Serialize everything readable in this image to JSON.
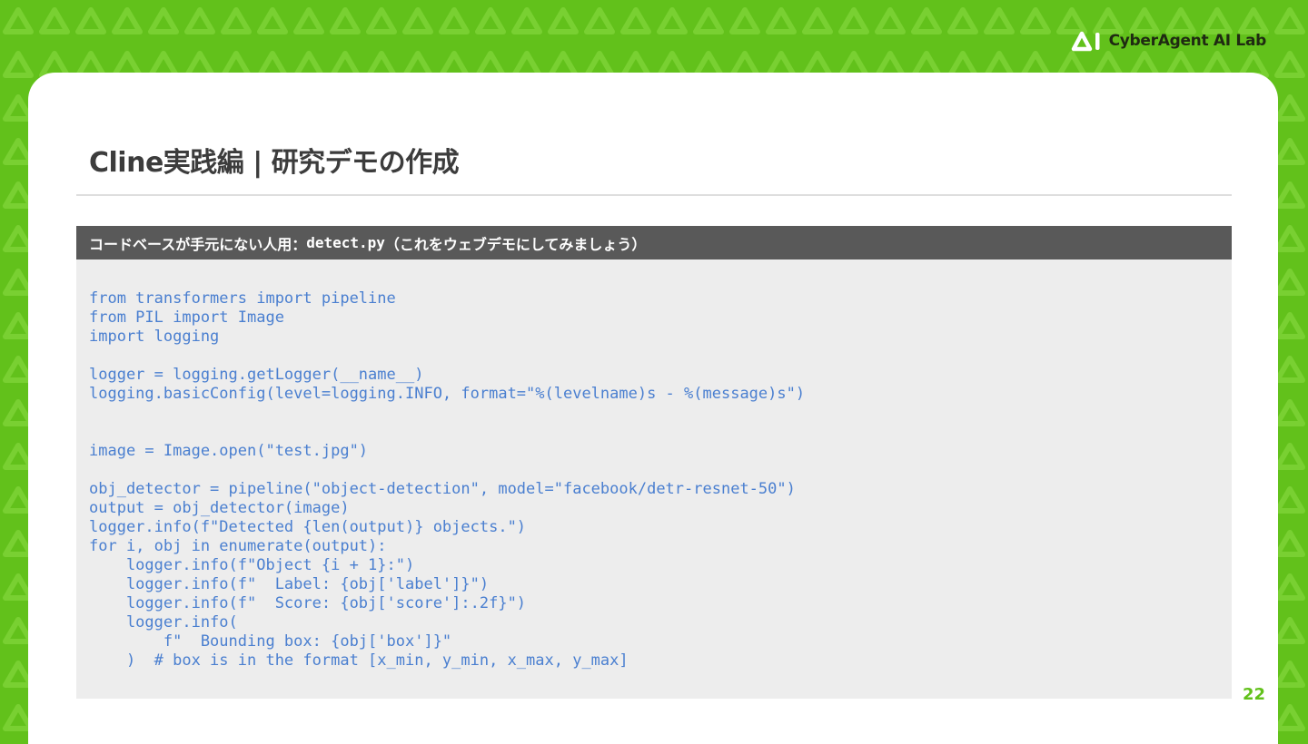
{
  "brand": {
    "logo_icon": "cyberagent-ai-logo-icon",
    "name": "CyberAgent AI Lab",
    "color": "#62c11b"
  },
  "slide": {
    "title": "Cline実践編 | 研究デモの作成",
    "page_number": "22"
  },
  "code_block": {
    "header_prefix": "コードベースが手元にない人用： ",
    "header_file": "detect.py",
    "header_suffix": "（これをウェブデモにしてみましょう）",
    "lines": [
      "from transformers import pipeline",
      "from PIL import Image",
      "import logging",
      "",
      "logger = logging.getLogger(__name__)",
      "logging.basicConfig(level=logging.INFO, format=\"%(levelname)s - %(message)s\")",
      "",
      "",
      "image = Image.open(\"test.jpg\")",
      "",
      "obj_detector = pipeline(\"object-detection\", model=\"facebook/detr-resnet-50\")",
      "output = obj_detector(image)",
      "logger.info(f\"Detected {len(output)} objects.\")",
      "for i, obj in enumerate(output):",
      "    logger.info(f\"Object {i + 1}:\")",
      "    logger.info(f\"  Label: {obj['label']}\")",
      "    logger.info(f\"  Score: {obj['score']:.2f}\")",
      "    logger.info(",
      "        f\"  Bounding box: {obj['box']}\"",
      "    )  # box is in the format [x_min, y_min, x_max, y_max]"
    ]
  }
}
